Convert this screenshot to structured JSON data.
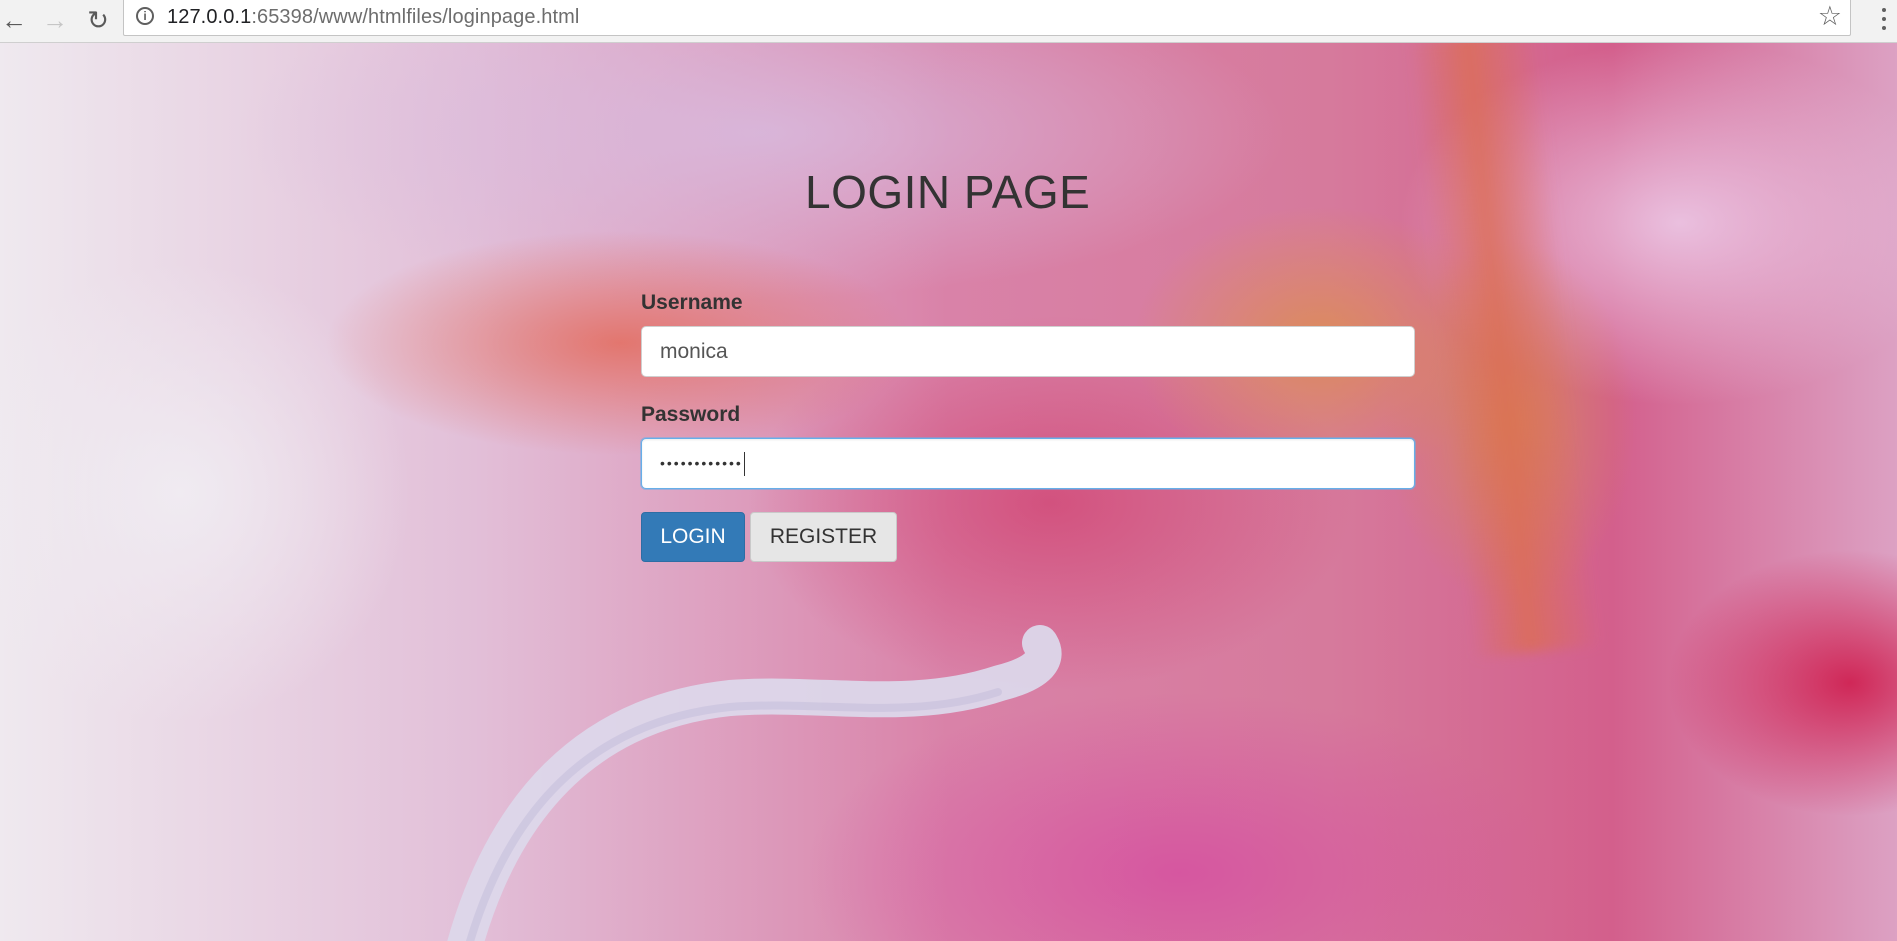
{
  "browser": {
    "url_host": "127.0.0.1",
    "url_path": ":65398/www/htmlfiles/loginpage.html",
    "icons": {
      "back": "arrow-left-icon",
      "forward": "arrow-right-icon",
      "reload": "reload-icon",
      "info": "info-icon",
      "bookmark": "star-icon",
      "menu": "kebab-menu-icon"
    }
  },
  "page": {
    "title": "LOGIN PAGE"
  },
  "form": {
    "username_label": "Username",
    "username_value": "monica",
    "password_label": "Password",
    "password_mask": "••••••••••••",
    "login_label": "LOGIN",
    "register_label": "REGISTER"
  },
  "colors": {
    "primary_button": "#337ab7",
    "default_button": "#e6e6e6",
    "focus_border": "#66afe9",
    "text": "#333333"
  }
}
